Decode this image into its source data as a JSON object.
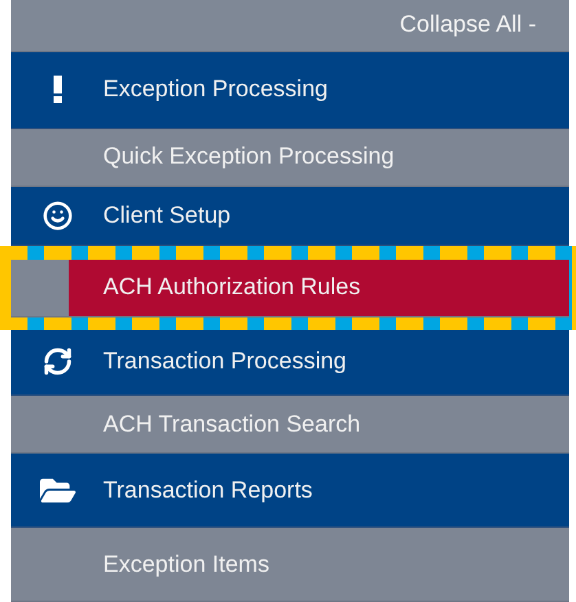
{
  "header": {
    "collapse_link": "Collapse All -"
  },
  "sections": [
    {
      "label": "Exception Processing",
      "children": [
        {
          "label": "Quick Exception Processing",
          "selected": false
        }
      ]
    },
    {
      "label": "Client Setup",
      "children": [
        {
          "label": "ACH Authorization Rules",
          "selected": true
        }
      ]
    },
    {
      "label": "Transaction Processing",
      "children": [
        {
          "label": "ACH Transaction Search",
          "selected": false
        }
      ]
    },
    {
      "label": "Transaction Reports",
      "children": [
        {
          "label": "Exception Items",
          "selected": false
        }
      ]
    }
  ]
}
